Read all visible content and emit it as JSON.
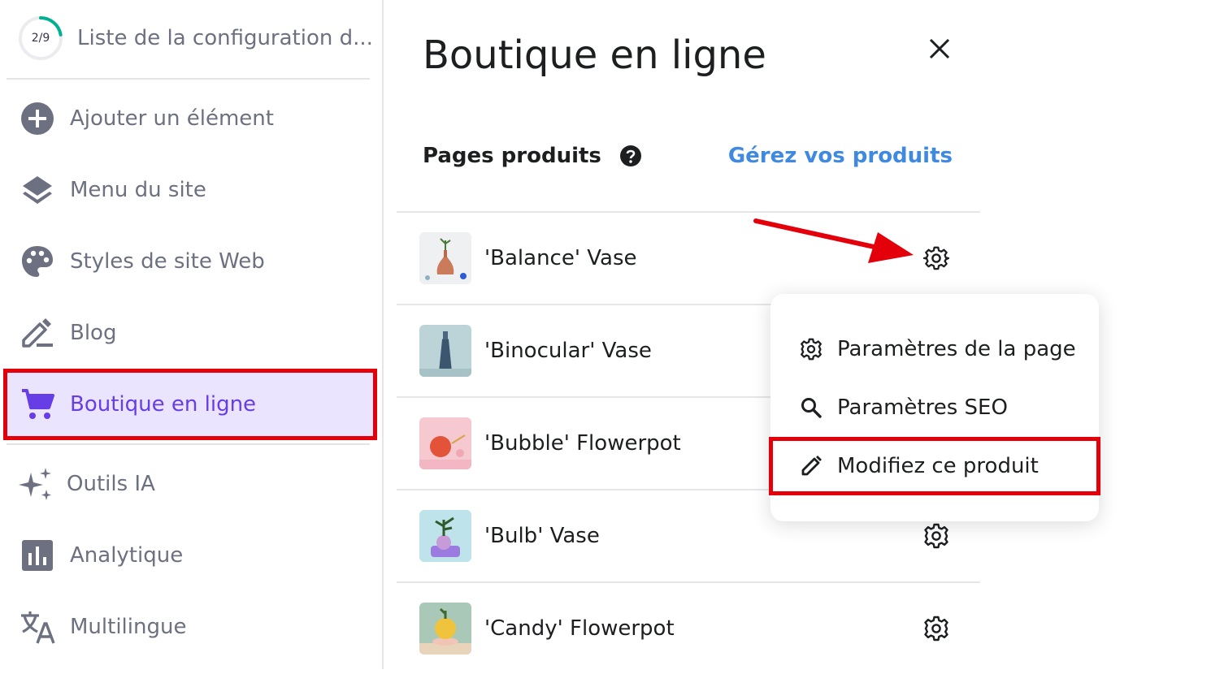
{
  "checklist": {
    "progress": "2/9",
    "progress_fraction": 0.22,
    "title": "Liste de la configuration d..."
  },
  "sidebar": {
    "items": [
      {
        "label": "Ajouter un élément",
        "icon": "plus-circle-icon"
      },
      {
        "label": "Menu du site",
        "icon": "layers-icon"
      },
      {
        "label": "Styles de site Web",
        "icon": "palette-icon"
      },
      {
        "label": "Blog",
        "icon": "edit-pen-icon"
      },
      {
        "label": "Boutique en ligne",
        "icon": "cart-icon",
        "active": true
      },
      {
        "label": "Outils IA",
        "icon": "sparkles-icon"
      },
      {
        "label": "Analytique",
        "icon": "bar-chart-icon"
      },
      {
        "label": "Multilingue",
        "icon": "translate-icon"
      }
    ]
  },
  "panel": {
    "title": "Boutique en ligne",
    "section_label": "Pages produits",
    "manage_link": "Gérez vos produits",
    "products": [
      {
        "name": "'Balance' Vase"
      },
      {
        "name": "'Binocular' Vase"
      },
      {
        "name": "'Bubble' Flowerpot"
      },
      {
        "name": "'Bulb' Vase"
      },
      {
        "name": "'Candy' Flowerpot"
      }
    ]
  },
  "menu": {
    "items": [
      {
        "label": "Paramètres de la page",
        "icon": "gear-icon"
      },
      {
        "label": "Paramètres SEO",
        "icon": "search-icon"
      },
      {
        "label": "Modifiez ce produit",
        "icon": "pencil-icon"
      }
    ]
  },
  "colors": {
    "accent": "#673de6",
    "active_bg": "#ebe4ff",
    "link": "#3f8ae0",
    "annotation": "#e3000b",
    "progress": "#00b090"
  }
}
